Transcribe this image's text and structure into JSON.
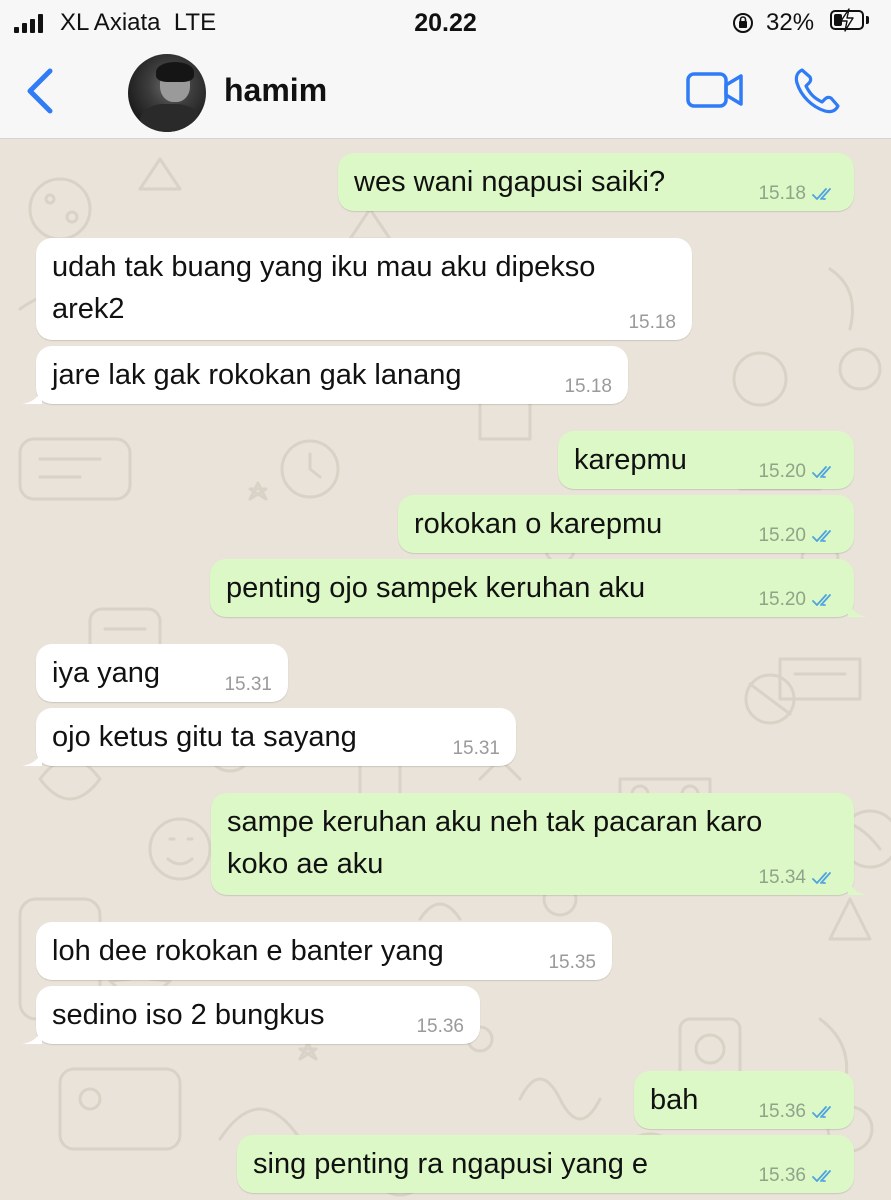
{
  "status_bar": {
    "carrier": "XL Axiata",
    "network": "LTE",
    "time": "20.22",
    "battery": "32%",
    "battery_level": 0.32
  },
  "header": {
    "contact_name": "hamim",
    "back_icon": "chevron-left-icon",
    "video_icon": "video-camera-icon",
    "call_icon": "phone-icon",
    "accent_color": "#2f7cf6"
  },
  "colors": {
    "incoming_bubble": "#ffffff",
    "outgoing_bubble": "#dcf8c6",
    "read_ticks": "#4fa3e0",
    "chat_background": "#e9e3d9"
  },
  "messages": [
    {
      "dir": "out",
      "text": "wes wani ngapusi saiki?",
      "time": "15.18",
      "read": true
    },
    {
      "dir": "in",
      "text": "udah tak buang yang iku mau aku dipekso\narek2",
      "time": "15.18"
    },
    {
      "dir": "in",
      "text": "jare lak gak rokokan gak lanang",
      "time": "15.18",
      "tail": true
    },
    {
      "dir": "out",
      "text": "karepmu",
      "time": "15.20",
      "read": true
    },
    {
      "dir": "out",
      "text": "rokokan o karepmu",
      "time": "15.20",
      "read": true
    },
    {
      "dir": "out",
      "text": "penting ojo sampek keruhan aku",
      "time": "15.20",
      "read": true,
      "tail": true
    },
    {
      "dir": "in",
      "text": "iya yang",
      "time": "15.31"
    },
    {
      "dir": "in",
      "text": "ojo ketus gitu ta sayang",
      "time": "15.31",
      "tail": true
    },
    {
      "dir": "out",
      "text": "sampe keruhan aku neh tak pacaran karo\nkoko ae aku",
      "time": "15.34",
      "read": true,
      "tail": true
    },
    {
      "dir": "in",
      "text": "loh dee rokokan e banter yang",
      "time": "15.35"
    },
    {
      "dir": "in",
      "text": "sedino iso 2 bungkus",
      "time": "15.36",
      "tail": true
    },
    {
      "dir": "out",
      "text": "bah",
      "time": "15.36",
      "read": true
    },
    {
      "dir": "out",
      "text": "sing penting ra ngapusi yang e",
      "time": "15.36",
      "read": true
    }
  ]
}
